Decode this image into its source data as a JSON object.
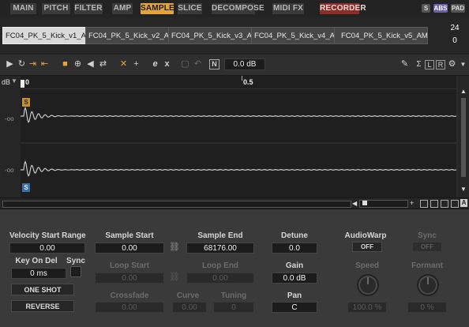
{
  "tabs": [
    "MAIN",
    "PITCH",
    "FILTER",
    "AMP",
    "SAMPLE",
    "SLICE",
    "DECOMPOSE",
    "MIDI FX",
    "RECORDER"
  ],
  "active_tab": "SAMPLE",
  "badges": {
    "s": "S",
    "abs": "ABS",
    "pad": "PAD"
  },
  "samples": [
    "FC04_PK_5_Kick_v1_AM",
    "FC04_PK_5_Kick_v2_AM",
    "FC04_PK_5_Kick_v3_AM",
    "FC04_PK_5_Kick_v4_AM",
    "FC04_PK_5_Kick_v5_AM"
  ],
  "counter": {
    "total": "24",
    "current": "0"
  },
  "toolbar": {
    "gain_value": "0.0 dB",
    "n_label": "N",
    "sigma": "Σ",
    "l": "L",
    "r": "R"
  },
  "waveform": {
    "db_label": "dB",
    "ruler_0": "0",
    "ruler_05": "0.5",
    "ch_label": "-oo",
    "start_marker": "S",
    "end_marker": "S"
  },
  "params": {
    "velocity_start_range": {
      "label": "Velocity Start Range",
      "value": "0.00"
    },
    "key_on_del": {
      "label": "Key On Del",
      "value": "0 ms"
    },
    "sync": {
      "label": "Sync"
    },
    "one_shot": "ONE SHOT",
    "reverse": "REVERSE",
    "sample_start": {
      "label": "Sample Start",
      "value": "0.00"
    },
    "sample_end": {
      "label": "Sample End",
      "value": "68176.00"
    },
    "loop_start": {
      "label": "Loop Start",
      "value": "0.00"
    },
    "loop_end": {
      "label": "Loop End",
      "value": "0.00"
    },
    "crossfade": {
      "label": "Crossfade",
      "value": "0.00"
    },
    "curve": {
      "label": "Curve",
      "value": "0.00"
    },
    "tuning": {
      "label": "Tuning",
      "value": "0"
    },
    "detune": {
      "label": "Detune",
      "value": "0.0"
    },
    "gain": {
      "label": "Gain",
      "value": "0.0 dB"
    },
    "pan": {
      "label": "Pan",
      "value": "C"
    },
    "audiowarp": {
      "label": "AudioWarp",
      "value": "OFF"
    },
    "sync2": {
      "label": "Sync",
      "value": "OFF"
    },
    "speed": {
      "label": "Speed",
      "value": "100.0 %"
    },
    "formant": {
      "label": "Formant",
      "value": "0 %"
    }
  },
  "colors": {
    "accent": "#e3a43a",
    "recorder": "#8a2e2a",
    "wave": "#c8c8c8"
  }
}
